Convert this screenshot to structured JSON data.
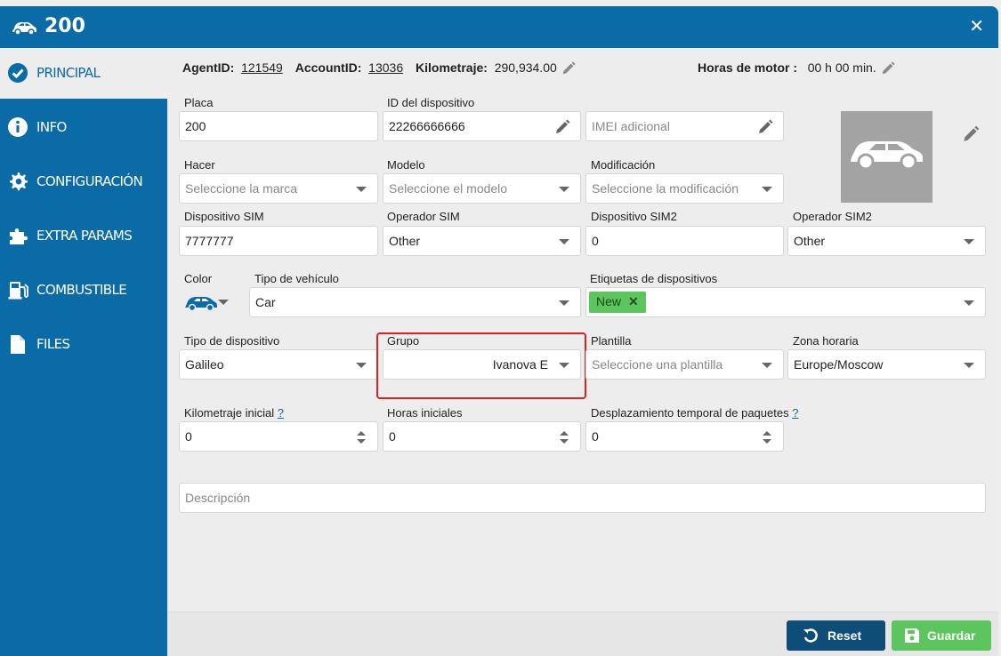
{
  "window": {
    "title": "200",
    "close_label": "✕"
  },
  "sidebar": {
    "items": [
      {
        "label": "PRINCIPAL"
      },
      {
        "label": "INFO"
      },
      {
        "label": "CONFIGURACIÓN"
      },
      {
        "label": "EXTRA PARAMS"
      },
      {
        "label": "COMBUSTIBLE"
      },
      {
        "label": "FILES"
      }
    ]
  },
  "info": {
    "agent_label": "AgentID:",
    "agent_value": "121549",
    "account_label": "AccountID:",
    "account_value": "13036",
    "km_label": "Kilometraje:",
    "km_value": "290,934.00",
    "engine_label": "Horas de motor :",
    "engine_value": "00 h 00 min."
  },
  "form": {
    "placa": {
      "label": "Placa",
      "value": "200"
    },
    "device_id": {
      "label": "ID del dispositivo",
      "value": "22266666666"
    },
    "imei": {
      "placeholder": "IMEI adicional"
    },
    "marca": {
      "label": "Hacer",
      "placeholder": "Seleccione la marca"
    },
    "modelo": {
      "label": "Modelo",
      "placeholder": "Seleccione el modelo"
    },
    "modificacion": {
      "label": "Modificación",
      "placeholder": "Seleccione la modificación"
    },
    "sim": {
      "label": "Dispositivo SIM",
      "value": "7777777"
    },
    "operador_sim": {
      "label": "Operador SIM",
      "value": "Other"
    },
    "sim2": {
      "label": "Dispositivo SIM2",
      "value": "0"
    },
    "operador_sim2": {
      "label": "Operador SIM2",
      "value": "Other"
    },
    "color": {
      "label": "Color"
    },
    "tipo_vehiculo": {
      "label": "Tipo de vehículo",
      "value": "Car"
    },
    "etiquetas": {
      "label": "Etiquetas de dispositivos",
      "tags": [
        "New"
      ]
    },
    "tipo_dispositivo": {
      "label": "Tipo de dispositivo",
      "value": "Galileo"
    },
    "grupo": {
      "label": "Grupo",
      "value": "Ivanova E"
    },
    "plantilla": {
      "label": "Plantilla",
      "placeholder": "Seleccione una plantilla"
    },
    "zona": {
      "label": "Zona horaria",
      "value": "Europe/Moscow"
    },
    "km_inicial": {
      "label": "Kilometraje inicial",
      "help": "?",
      "value": "0"
    },
    "horas_iniciales": {
      "label": "Horas iniciales",
      "value": "0"
    },
    "desplazamiento": {
      "label": "Desplazamiento temporal de paquetes",
      "help": "?",
      "value": "0"
    },
    "descripcion": {
      "placeholder": "Descripción"
    }
  },
  "footer": {
    "reset_label": "Reset",
    "save_label": "Guardar"
  },
  "colors": {
    "primary": "#0b6ba7",
    "reset_button": "#0e4d78",
    "save_button": "#5dc55d",
    "highlight": "#e02020",
    "vehicle_color": "#0b6ba7"
  }
}
